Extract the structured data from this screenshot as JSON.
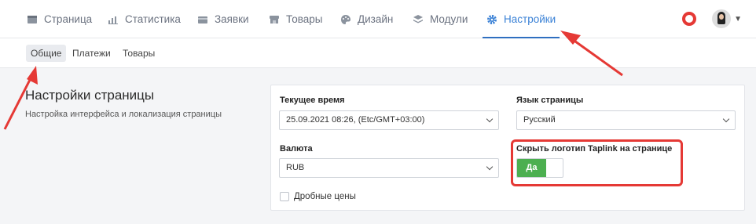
{
  "nav": {
    "items": [
      {
        "label": "Страница",
        "icon": "page-icon"
      },
      {
        "label": "Статистика",
        "icon": "chart-icon"
      },
      {
        "label": "Заявки",
        "icon": "requests-icon"
      },
      {
        "label": "Товары",
        "icon": "store-icon"
      },
      {
        "label": "Дизайн",
        "icon": "palette-icon"
      },
      {
        "label": "Модули",
        "icon": "layers-icon"
      },
      {
        "label": "Настройки",
        "icon": "gear-icon"
      }
    ],
    "active": "Настройки"
  },
  "subnav": {
    "items": [
      {
        "label": "Общие"
      },
      {
        "label": "Платежи"
      },
      {
        "label": "Товары"
      }
    ],
    "active": "Общие"
  },
  "section": {
    "title": "Настройки страницы",
    "description": "Настройка интерфейса и локализация страницы"
  },
  "form": {
    "time_label": "Текущее время",
    "time_value": "25.09.2021 08:26, (Etc/GMT+03:00)",
    "language_label": "Язык страницы",
    "language_value": "Русский",
    "currency_label": "Валюта",
    "currency_value": "RUB",
    "hide_logo_label": "Скрыть логотип Taplink на странице",
    "hide_logo_toggle": "Да",
    "fractional_label": "Дробные цены"
  },
  "colors": {
    "accent": "#3b82d6",
    "annotation": "#e53935",
    "toggle_on": "#4caf50"
  }
}
